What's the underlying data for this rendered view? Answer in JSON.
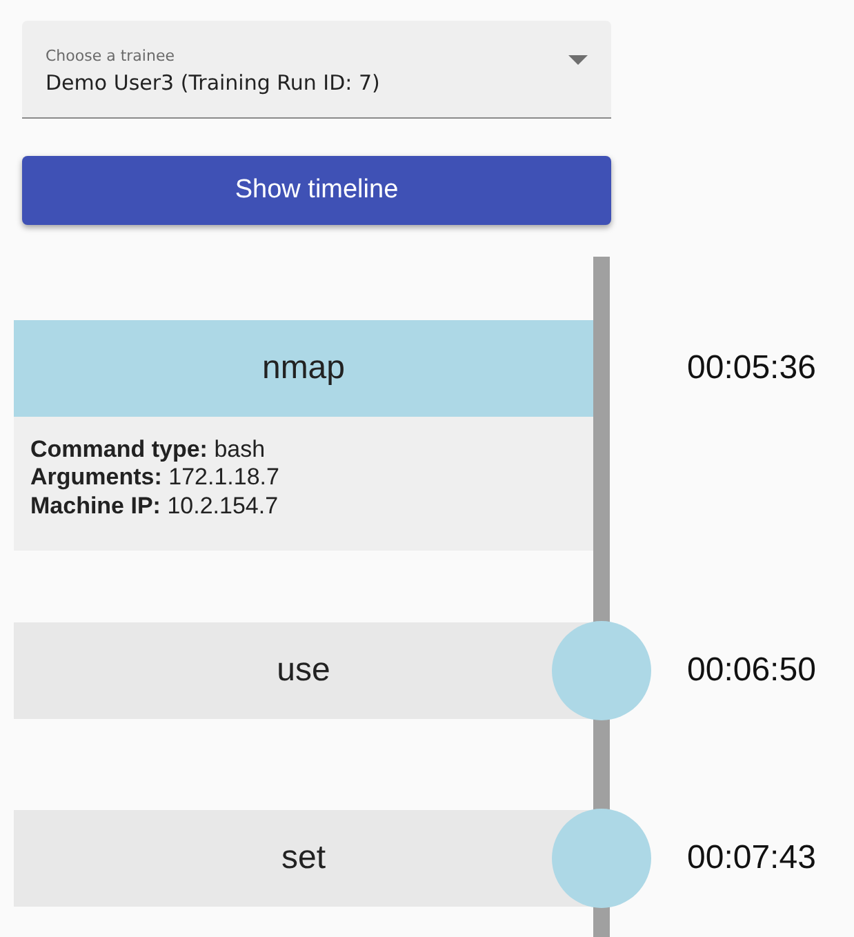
{
  "trainee_select": {
    "label": "Choose a trainee",
    "value": "Demo User3 (Training Run ID: 7)"
  },
  "show_button": "Show timeline",
  "events": [
    {
      "name": "nmap",
      "time": "00:05:36",
      "expanded": true,
      "details": [
        "**Command type:** bash",
        "**Arguments:** 172.1.18.7",
        "**Machine IP:** 10.2.154.7"
      ]
    },
    {
      "name": "use",
      "time": "00:06:50",
      "expanded": false
    },
    {
      "name": "set",
      "time": "00:07:43",
      "expanded": false
    }
  ]
}
